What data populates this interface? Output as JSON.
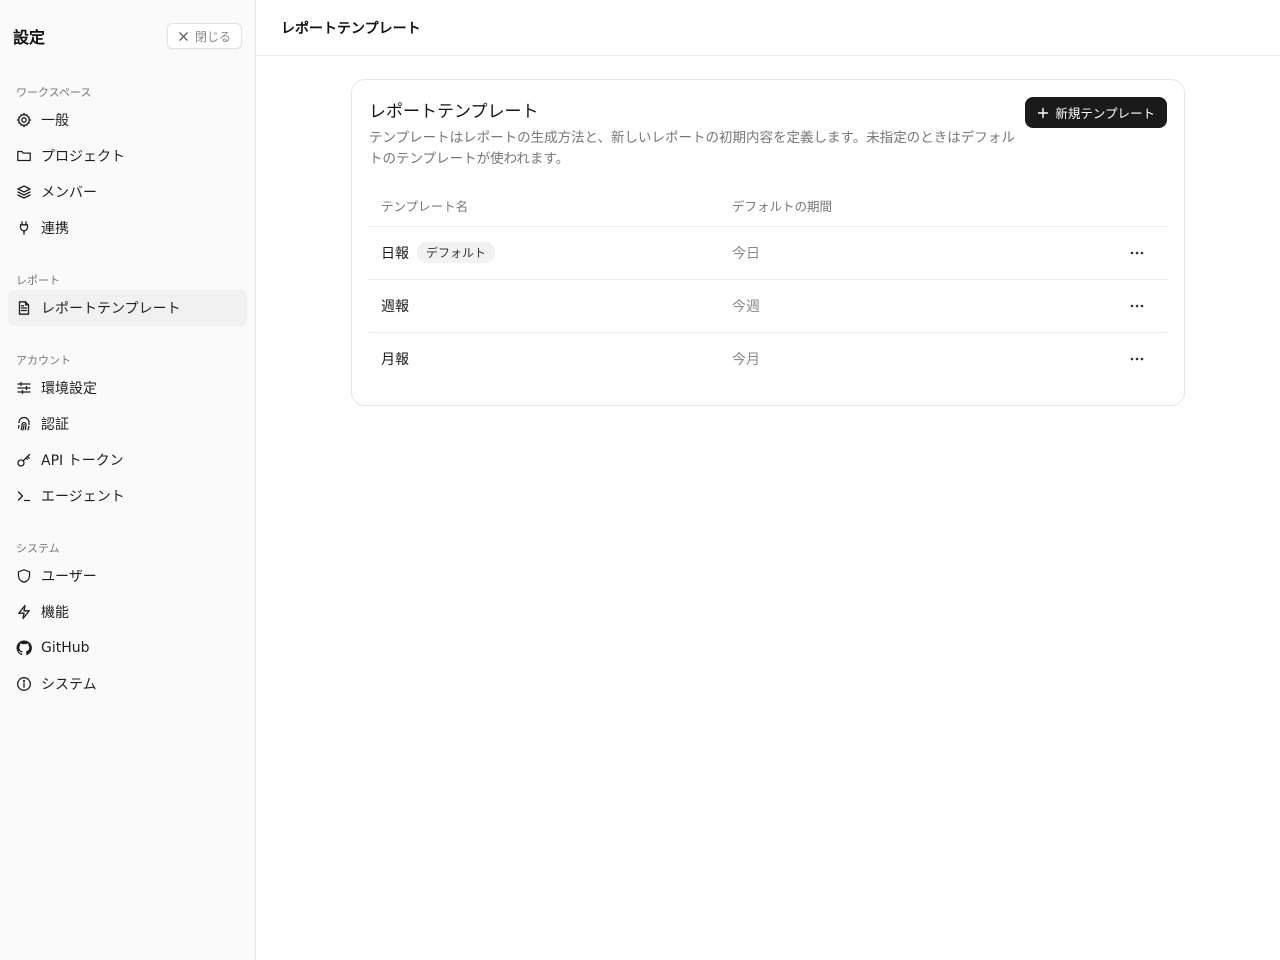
{
  "sidebar": {
    "title": "設定",
    "close_label": "閉じる",
    "sections": [
      {
        "label": "ワークスペース",
        "items": [
          {
            "label": "一般",
            "icon": "gear-icon"
          },
          {
            "label": "プロジェクト",
            "icon": "folder-icon"
          },
          {
            "label": "メンバー",
            "icon": "layers-icon"
          },
          {
            "label": "連携",
            "icon": "plug-icon"
          }
        ]
      },
      {
        "label": "レポート",
        "items": [
          {
            "label": "レポートテンプレート",
            "icon": "file-text-icon",
            "active": true
          }
        ]
      },
      {
        "label": "アカウント",
        "items": [
          {
            "label": "環境設定",
            "icon": "sliders-icon"
          },
          {
            "label": "認証",
            "icon": "fingerprint-icon"
          },
          {
            "label": "API トークン",
            "icon": "key-icon"
          },
          {
            "label": "エージェント",
            "icon": "terminal-icon"
          }
        ]
      },
      {
        "label": "システム",
        "items": [
          {
            "label": "ユーザー",
            "icon": "shield-icon"
          },
          {
            "label": "機能",
            "icon": "zap-icon"
          },
          {
            "label": "GitHub",
            "icon": "github-icon"
          },
          {
            "label": "システム",
            "icon": "info-icon"
          }
        ]
      }
    ]
  },
  "topbar": {
    "title": "レポートテンプレート"
  },
  "card": {
    "title": "レポートテンプレート",
    "description": "テンプレートはレポートの生成方法と、新しいレポートの初期内容を定義します。未指定のときはデフォルトのテンプレートが使われます。",
    "new_button_label": "新規テンプレート"
  },
  "table": {
    "columns": [
      "テンプレート名",
      "デフォルトの期間"
    ],
    "rows": [
      {
        "name": "日報",
        "badge": "デフォルト",
        "period": "今日"
      },
      {
        "name": "週報",
        "badge": "",
        "period": "今週"
      },
      {
        "name": "月報",
        "badge": "",
        "period": "今月"
      }
    ]
  }
}
